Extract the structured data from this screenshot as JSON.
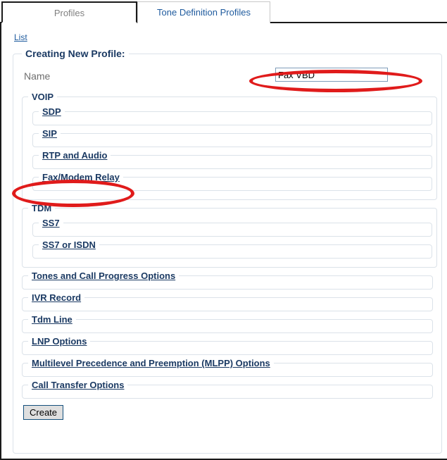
{
  "tabs": [
    {
      "label": "Profiles",
      "active": true
    },
    {
      "label": "Tone Definition Profiles",
      "active": false
    }
  ],
  "breadcrumb": {
    "list_link": "List"
  },
  "form": {
    "legend": "Creating New Profile:",
    "name_label": "Name",
    "name_value": "Fax VBD",
    "name_placeholder": "",
    "create_label": "Create"
  },
  "sections": {
    "voip": {
      "legend": "VOIP",
      "items": [
        {
          "label": "SDP"
        },
        {
          "label": "SIP"
        },
        {
          "label": "RTP and Audio"
        },
        {
          "label": "Fax/Modem Relay"
        }
      ]
    },
    "tdm": {
      "legend": "TDM",
      "items": [
        {
          "label": "SS7"
        },
        {
          "label": "SS7 or ISDN"
        }
      ]
    },
    "top_level": [
      {
        "label": "Tones and Call Progress Options"
      },
      {
        "label": "IVR Record"
      },
      {
        "label": "Tdm Line"
      },
      {
        "label": "LNP Options"
      },
      {
        "label": "Multilevel Precedence and Preemption (MLPP) Options"
      },
      {
        "label": "Call Transfer Options"
      }
    ]
  },
  "annotations": [
    {
      "name": "name-field-highlight",
      "shape": "ellipse",
      "color": "#e01b1b"
    },
    {
      "name": "fax-modem-relay-highlight",
      "shape": "ellipse",
      "color": "#e01b1b"
    }
  ],
  "colors": {
    "link": "#1f5b9e",
    "legend": "#1b3a63",
    "annotation": "#e01b1b",
    "fieldset_border": "#dbe2e9",
    "panel_border": "#1a1a1a"
  }
}
